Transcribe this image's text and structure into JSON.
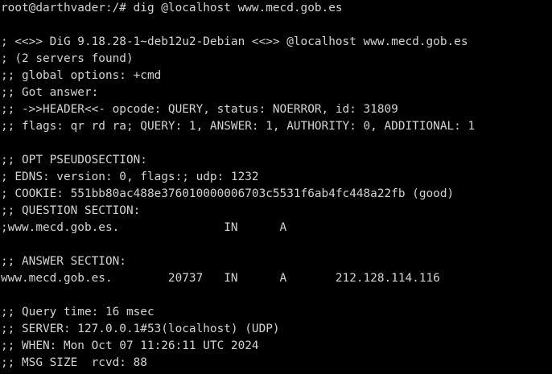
{
  "terminal": {
    "background": "#000000",
    "foreground": "#d3d3d3",
    "lines": [
      "root@darthvader:/# dig @localhost www.mecd.gob.es",
      "",
      "; <<>> DiG 9.18.28-1~deb12u2-Debian <<>> @localhost www.mecd.gob.es",
      "; (2 servers found)",
      ";; global options: +cmd",
      ";; Got answer:",
      ";; ->>HEADER<<- opcode: QUERY, status: NOERROR, id: 31809",
      ";; flags: qr rd ra; QUERY: 1, ANSWER: 1, AUTHORITY: 0, ADDITIONAL: 1",
      "",
      ";; OPT PSEUDOSECTION:",
      "; EDNS: version: 0, flags:; udp: 1232",
      "; COOKIE: 551bb80ac488e376010000006703c5531f6ab4fc448a22fb (good)",
      ";; QUESTION SECTION:",
      ";www.mecd.gob.es.               IN      A",
      "",
      ";; ANSWER SECTION:",
      "www.mecd.gob.es.        20737   IN      A       212.128.114.116",
      "",
      ";; Query time: 16 msec",
      ";; SERVER: 127.0.0.1#53(localhost) (UDP)",
      ";; WHEN: Mon Oct 07 11:26:11 UTC 2024",
      ";; MSG SIZE  rcvd: 88"
    ]
  }
}
